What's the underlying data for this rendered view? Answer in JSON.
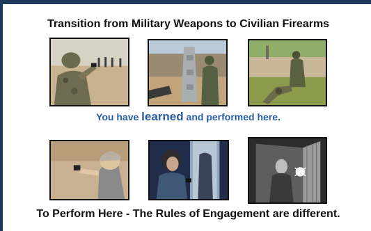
{
  "slide": {
    "title": "Transition from Military Weapons to Civilian Firearms",
    "caption_part1": "You have ",
    "caption_emphasis": "learned",
    "caption_part2": " and performed here.",
    "footer": "To Perform Here - The Rules of Engagement are different."
  },
  "colors": {
    "border_accent": "#1e3a5a",
    "caption_blue": "#2a5da4",
    "text_dark": "#111111"
  },
  "photos": {
    "top_row": [
      "soldier-aiming-pistol-range-photo",
      "soldier-at-steel-barricade-photo",
      "soldier-dragging-casualty-photo"
    ],
    "bottom_row": [
      "woman-shooting-pistol-range-photo",
      "woman-with-gun-at-door-photo",
      "intruder-in-doorway-photo"
    ]
  }
}
